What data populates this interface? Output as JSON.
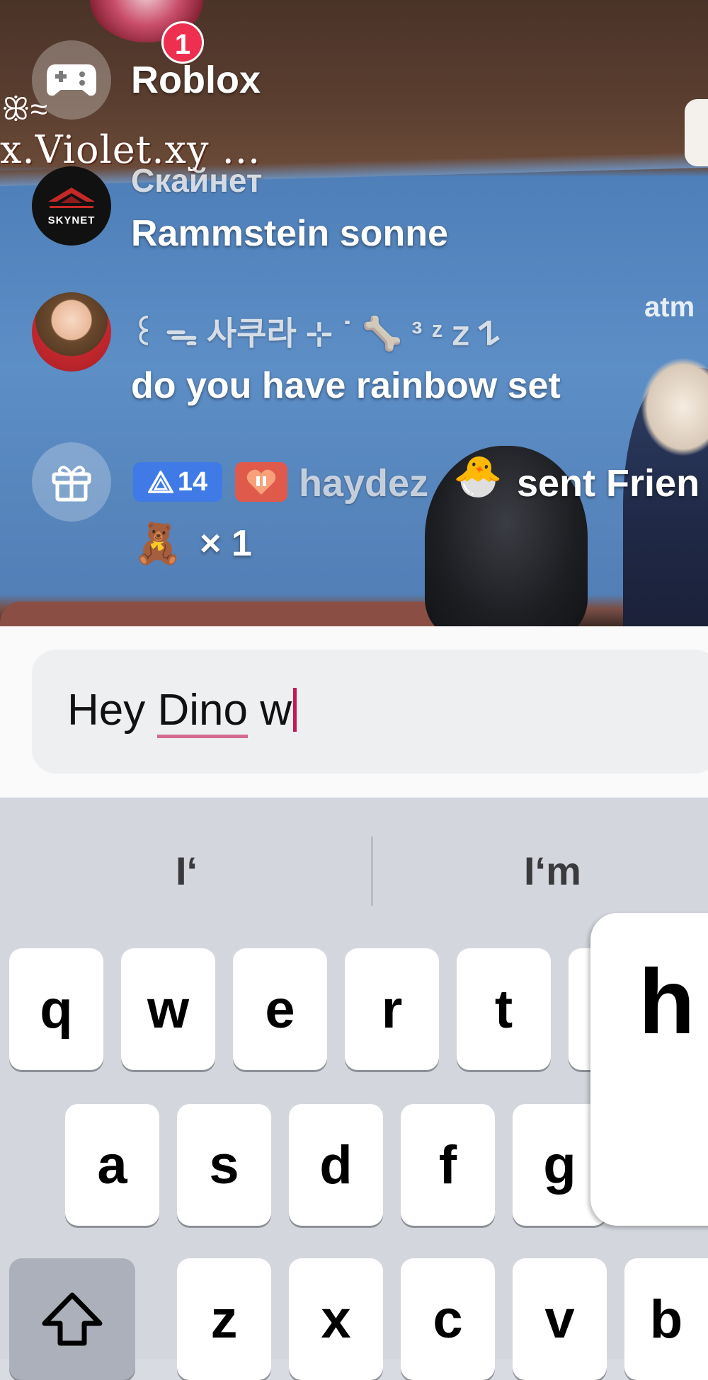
{
  "stream": {
    "overlay_name": "x.Violet.xy ...",
    "overlay_deco": "ꕥ≈",
    "side_text": "atm"
  },
  "notification": {
    "badge_count": "1"
  },
  "chat": [
    {
      "type": "app",
      "title": "Roblox",
      "icon": "game-controller-icon"
    },
    {
      "type": "message",
      "avatar": "skynet-avatar",
      "avatar_label": "SKYNET",
      "username": "Скайнет",
      "text": "Rammstein sonne"
    },
    {
      "type": "message",
      "avatar": "anime-avatar",
      "username": "꒰ ᯓ 사쿠라 ⊹ ˙ 🦴 ³ ᶻ 𝗓 𐰁",
      "text": "do you have rainbow set"
    }
  ],
  "gift": {
    "icon": "gift-icon",
    "level": "14",
    "username": "haydez",
    "username_emoji": "🐣",
    "action": "sent Frien",
    "gift_emoji": "🧸",
    "count": "× 1"
  },
  "input": {
    "text_prefix": "Hey ",
    "text_underlined": "Dino",
    "text_suffix": " w"
  },
  "keyboard": {
    "suggestions": [
      "I‘",
      "I‘m"
    ],
    "row1": [
      "q",
      "w",
      "e",
      "r",
      "t"
    ],
    "row2": [
      "a",
      "s",
      "d",
      "f",
      "g"
    ],
    "row3": [
      "z",
      "x",
      "c",
      "v",
      "b"
    ],
    "popup_key": "h"
  },
  "colors": {
    "level_badge": "#3f7ae6",
    "heart_badge": "#e05a4c",
    "notification_badge": "#ee2f4f",
    "caret": "#c2185b"
  }
}
